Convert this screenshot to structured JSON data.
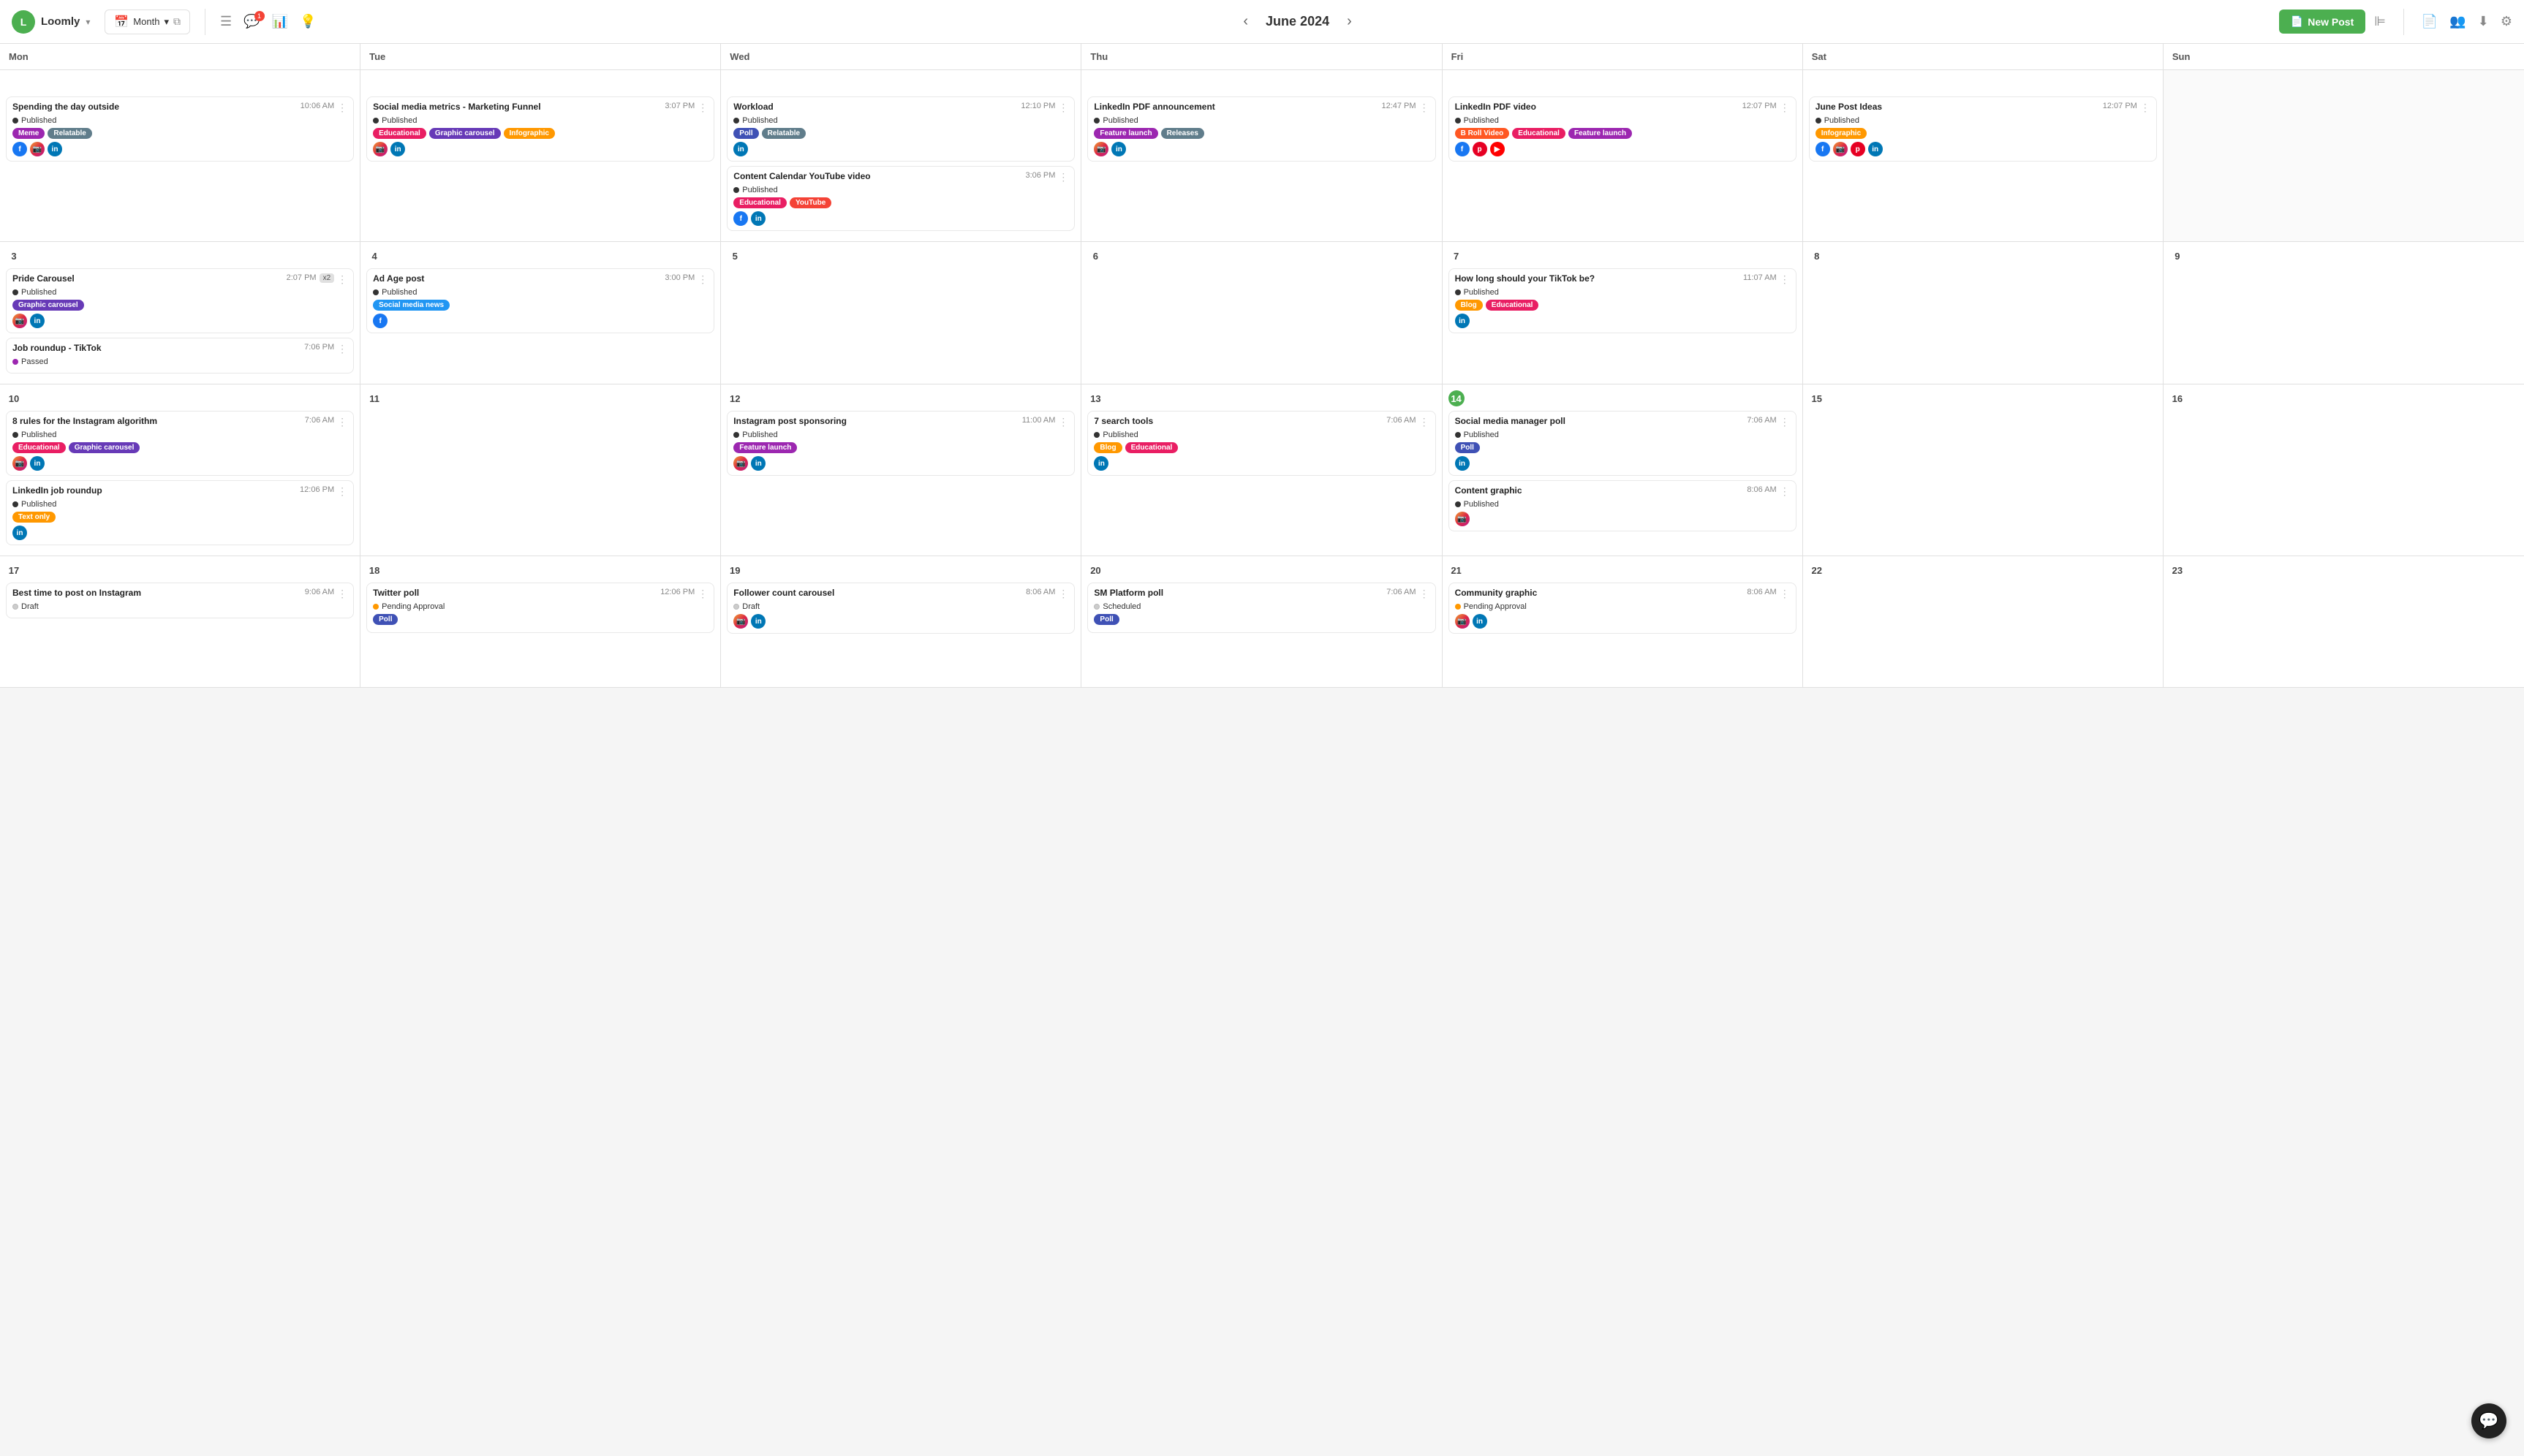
{
  "header": {
    "logo_letter": "L",
    "app_name": "Loomly",
    "month_label": "Month",
    "nav_title": "June 2024",
    "new_post_label": "New Post",
    "icons": {
      "list": "☰",
      "chat": "💬",
      "chart": "📊",
      "bulb": "💡",
      "filter": "⊫",
      "doc": "📄",
      "people": "👥",
      "download": "⬇",
      "gear": "⚙"
    }
  },
  "day_headers": [
    "Mon",
    "Tue",
    "Wed",
    "Thu",
    "Fri",
    "Sat",
    "Sun"
  ],
  "weeks": [
    {
      "days": [
        {
          "num": "",
          "other": false,
          "posts": [
            {
              "title": "Spending the day outside",
              "time": "10:06 AM",
              "status": "Published",
              "status_type": "published",
              "tags": [
                {
                  "label": "Meme",
                  "class": "tag-meme"
                },
                {
                  "label": "Relatable",
                  "class": "tag-relatable"
                }
              ],
              "socials": [
                "fb",
                "ig",
                "li"
              ]
            }
          ]
        },
        {
          "num": "",
          "other": false,
          "posts": [
            {
              "title": "Social media metrics - Marketing Funnel",
              "time": "3:07 PM",
              "status": "Published",
              "status_type": "published",
              "tags": [
                {
                  "label": "Educational",
                  "class": "tag-educational"
                },
                {
                  "label": "Graphic carousel",
                  "class": "tag-graphic-carousel"
                }
              ],
              "extra_tags": [
                {
                  "label": "Infographic",
                  "class": "tag-infographic"
                }
              ],
              "socials": [
                "ig",
                "li"
              ]
            }
          ]
        },
        {
          "num": "",
          "other": false,
          "posts": [
            {
              "title": "Workload",
              "time": "12:10 PM",
              "status": "Published",
              "status_type": "published",
              "tags": [
                {
                  "label": "Poll",
                  "class": "tag-poll"
                },
                {
                  "label": "Relatable",
                  "class": "tag-relatable"
                }
              ],
              "socials": [
                "li"
              ]
            },
            {
              "title": "Content Calendar YouTube video",
              "time": "3:06 PM",
              "status": "Published",
              "status_type": "published",
              "tags": [
                {
                  "label": "Educational",
                  "class": "tag-educational"
                },
                {
                  "label": "YouTube",
                  "class": "tag-youtube"
                }
              ],
              "socials": [
                "fb",
                "li"
              ]
            }
          ]
        },
        {
          "num": "",
          "other": false,
          "posts": [
            {
              "title": "LinkedIn PDF announcement",
              "time": "12:47 PM",
              "status": "Published",
              "status_type": "published",
              "tags": [
                {
                  "label": "Feature launch",
                  "class": "tag-feature-launch"
                },
                {
                  "label": "Releases",
                  "class": "tag-releases"
                }
              ],
              "socials": [
                "ig",
                "li"
              ]
            }
          ]
        },
        {
          "num": "",
          "other": false,
          "posts": [
            {
              "title": "LinkedIn PDF video",
              "time": "12:07 PM",
              "status": "Published",
              "status_type": "published",
              "tags": [
                {
                  "label": "B Roll Video",
                  "class": "tag-b-roll"
                },
                {
                  "label": "Educational",
                  "class": "tag-educational"
                }
              ],
              "extra_tags": [
                {
                  "label": "Feature launch",
                  "class": "tag-feature-launch"
                }
              ],
              "socials": [
                "fb",
                "pi",
                "yt"
              ]
            }
          ]
        },
        {
          "num": "",
          "other": false,
          "posts": [
            {
              "title": "June Post Ideas",
              "time": "12:07 PM",
              "status": "Published",
              "status_type": "published",
              "tags": [
                {
                  "label": "Infographic",
                  "class": "tag-infographic"
                }
              ],
              "socials": [
                "fb",
                "ig",
                "pi",
                "li"
              ]
            }
          ]
        },
        {
          "num": "",
          "other": true,
          "posts": []
        }
      ]
    },
    {
      "days": [
        {
          "num": "3",
          "other": false,
          "posts": [
            {
              "title": "Pride Carousel",
              "time": "2:07 PM",
              "time_badge": "x2",
              "status": "Published",
              "status_type": "published",
              "tags": [
                {
                  "label": "Graphic carousel",
                  "class": "tag-graphic-carousel"
                }
              ],
              "socials": [
                "ig",
                "li"
              ]
            },
            {
              "title": "Job roundup - TikTok",
              "time": "7:06 PM",
              "status": "Passed",
              "status_type": "passed",
              "tags": [],
              "socials": []
            }
          ]
        },
        {
          "num": "4",
          "other": false,
          "posts": [
            {
              "title": "Ad Age post",
              "time": "3:00 PM",
              "status": "Published",
              "status_type": "published",
              "tags": [
                {
                  "label": "Social media news",
                  "class": "tag-social-media-news"
                }
              ],
              "socials": [
                "fb"
              ]
            }
          ]
        },
        {
          "num": "5",
          "other": false,
          "posts": []
        },
        {
          "num": "6",
          "other": false,
          "posts": []
        },
        {
          "num": "7",
          "other": false,
          "posts": [
            {
              "title": "How long should your TikTok be?",
              "time": "11:07 AM",
              "status": "Published",
              "status_type": "published",
              "tags": [
                {
                  "label": "Blog",
                  "class": "tag-blog"
                },
                {
                  "label": "Educational",
                  "class": "tag-educational"
                }
              ],
              "socials": [
                "li"
              ]
            }
          ]
        },
        {
          "num": "8",
          "other": false,
          "posts": []
        },
        {
          "num": "9",
          "other": false,
          "posts": []
        }
      ]
    },
    {
      "days": [
        {
          "num": "10",
          "other": false,
          "posts": [
            {
              "title": "8 rules for the Instagram algorithm",
              "time": "7:06 AM",
              "status": "Published",
              "status_type": "published",
              "tags": [
                {
                  "label": "Educational",
                  "class": "tag-educational"
                },
                {
                  "label": "Graphic carousel",
                  "class": "tag-graphic-carousel"
                }
              ],
              "socials": [
                "ig",
                "li"
              ]
            },
            {
              "title": "LinkedIn job roundup",
              "time": "12:06 PM",
              "status": "Published",
              "status_type": "published",
              "tags": [
                {
                  "label": "Text only",
                  "class": "tag-text-only"
                }
              ],
              "socials": [
                "li"
              ]
            }
          ]
        },
        {
          "num": "11",
          "other": false,
          "posts": []
        },
        {
          "num": "12",
          "other": false,
          "posts": [
            {
              "title": "Instagram post sponsoring",
              "time": "11:00 AM",
              "status": "Published",
              "status_type": "published",
              "tags": [
                {
                  "label": "Feature launch",
                  "class": "tag-feature-launch"
                }
              ],
              "socials": [
                "ig",
                "li"
              ]
            }
          ]
        },
        {
          "num": "13",
          "other": false,
          "posts": [
            {
              "title": "7 search tools",
              "time": "7:06 AM",
              "status": "Published",
              "status_type": "published",
              "tags": [
                {
                  "label": "Blog",
                  "class": "tag-blog"
                },
                {
                  "label": "Educational",
                  "class": "tag-educational"
                }
              ],
              "socials": [
                "li"
              ]
            }
          ]
        },
        {
          "num": "14",
          "other": false,
          "today": true,
          "posts": [
            {
              "title": "Social media manager poll",
              "time": "7:06 AM",
              "status": "Published",
              "status_type": "published",
              "tags": [
                {
                  "label": "Poll",
                  "class": "tag-poll"
                }
              ],
              "socials": [
                "li"
              ]
            },
            {
              "title": "Content graphic",
              "time": "8:06 AM",
              "status": "Published",
              "status_type": "published",
              "tags": [],
              "socials": [
                "ig"
              ]
            }
          ]
        },
        {
          "num": "15",
          "other": false,
          "posts": []
        },
        {
          "num": "16",
          "other": false,
          "posts": []
        }
      ]
    },
    {
      "days": [
        {
          "num": "17",
          "other": false,
          "posts": [
            {
              "title": "Best time to post on Instagram",
              "time": "9:06 AM",
              "status": "Draft",
              "status_type": "draft",
              "tags": [],
              "socials": []
            }
          ]
        },
        {
          "num": "18",
          "other": false,
          "posts": [
            {
              "title": "Twitter poll",
              "time": "12:06 PM",
              "status": "Pending Approval",
              "status_type": "pending",
              "tags": [
                {
                  "label": "Poll",
                  "class": "tag-poll"
                }
              ],
              "socials": []
            }
          ]
        },
        {
          "num": "19",
          "other": false,
          "posts": [
            {
              "title": "Follower count carousel",
              "time": "8:06 AM",
              "status": "Draft",
              "status_type": "draft",
              "tags": [],
              "socials": [
                "ig",
                "li"
              ]
            }
          ]
        },
        {
          "num": "20",
          "other": false,
          "posts": [
            {
              "title": "SM Platform poll",
              "time": "7:06 AM",
              "status": "Scheduled",
              "status_type": "scheduled",
              "tags": [
                {
                  "label": "Poll",
                  "class": "tag-poll"
                }
              ],
              "socials": []
            }
          ]
        },
        {
          "num": "21",
          "other": false,
          "posts": [
            {
              "title": "Community graphic",
              "time": "8:06 AM",
              "status": "Pending Approval",
              "status_type": "pending",
              "tags": [],
              "socials": [
                "ig",
                "li"
              ]
            }
          ]
        },
        {
          "num": "22",
          "other": false,
          "posts": []
        },
        {
          "num": "23",
          "other": false,
          "posts": []
        }
      ]
    }
  ]
}
